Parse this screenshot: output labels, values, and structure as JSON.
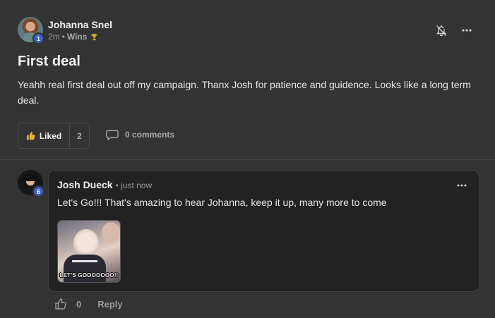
{
  "post": {
    "author": "Johanna Snel",
    "author_level": "1",
    "time": "2m",
    "separator": "•",
    "category": "Wins",
    "title": "First deal",
    "body": "Yeahh real first deal out off my campaign. Thanx Josh for patience and guidence. Looks like a long term deal.",
    "liked_label": "Liked",
    "likes": "2",
    "comments_label": "0 comments"
  },
  "comment": {
    "author": "Josh Dueck",
    "author_level": "6",
    "time": "• just now",
    "text": "Let's Go!!! That's amazing to hear Johanna, keep it up, many more to come",
    "gif_caption": "LET'S GOOOOOOO!!",
    "likes": "0",
    "reply_label": "Reply"
  },
  "colors": {
    "background": "#333333",
    "card": "#222222",
    "badge": "#3c5fc9",
    "trophy": "#c9a227",
    "thumb": "#e5b33a"
  },
  "icons": [
    "bell-off-icon",
    "more-icon",
    "thumb-up-icon",
    "comment-icon",
    "trophy-icon"
  ]
}
